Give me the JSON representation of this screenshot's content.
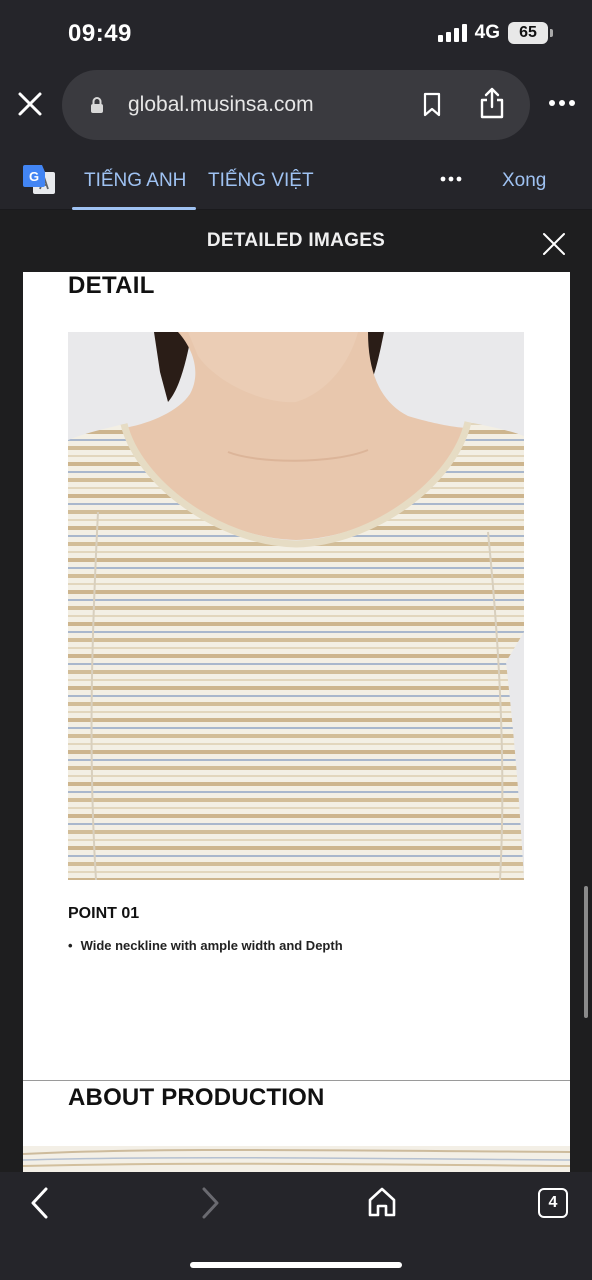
{
  "status_bar": {
    "time": "09:49",
    "network": "4G",
    "battery": "65"
  },
  "browser": {
    "url": "global.musinsa.com",
    "icons": [
      "close-icon",
      "lock-icon",
      "bookmark-icon",
      "share-icon",
      "more-icon"
    ]
  },
  "translate_bar": {
    "tabs": [
      {
        "label": "TIẾNG ANH",
        "selected": true
      },
      {
        "label": "TIẾNG VIỆT",
        "selected": false
      }
    ],
    "done_label": "Xong",
    "accent_color": "#9fc2f2"
  },
  "modal": {
    "title": "DETAILED IMAGES"
  },
  "content": {
    "detail_heading": "DETAIL",
    "point_title": "POINT 01",
    "point_bullet_mark": "•",
    "point_bullet": "Wide neckline with ample width and Depth",
    "about_heading": "ABOUT PRODUCTION"
  },
  "bottom_bar": {
    "tab_count": "4"
  }
}
